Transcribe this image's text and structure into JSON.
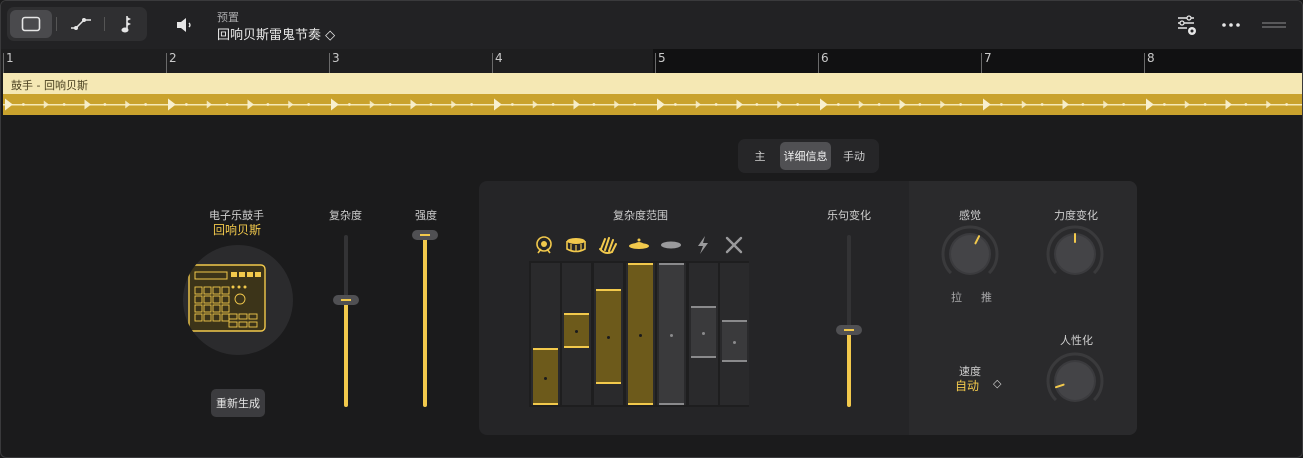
{
  "colors": {
    "accent": "#f2c94c",
    "region_header": "#f5e8b4",
    "region_body": "#c9a22d"
  },
  "toolbar": {
    "view_buttons": [
      {
        "icon": "single-window-icon",
        "active": true
      },
      {
        "icon": "automation-curve-icon",
        "active": false
      },
      {
        "icon": "score-note-icon",
        "active": false
      }
    ],
    "speaker_icon": "speaker-icon",
    "preset_label": "预置",
    "preset_name": "回响贝斯雷鬼节奏 ◇",
    "right_icons": [
      "mixer-settings-icon",
      "more-icon",
      "drag-handle-icon"
    ]
  },
  "ruler": {
    "bars": [
      "1",
      "2",
      "3",
      "4",
      "5",
      "6",
      "7",
      "8"
    ]
  },
  "region": {
    "name": "鼓手 - 回响贝斯"
  },
  "tabs": [
    {
      "label": "主",
      "active": false
    },
    {
      "label": "详细信息",
      "active": true
    },
    {
      "label": "手动",
      "active": false
    }
  ],
  "drummer": {
    "label": "电子乐鼓手",
    "name": "回响贝斯",
    "regenerate": "重新生成"
  },
  "sliders": {
    "complexity": {
      "label": "复杂度",
      "value": 0.62
    },
    "intensity": {
      "label": "强度",
      "value": 1.0
    },
    "fill": {
      "label": "乐句变化",
      "value": 0.45
    }
  },
  "complexity_range": {
    "label": "复杂度范围",
    "instruments": [
      {
        "icon": "kick-drum-icon",
        "color": "gold",
        "low": 0.0,
        "high": 0.4
      },
      {
        "icon": "snare-drum-icon",
        "color": "gold",
        "low": 0.4,
        "high": 0.65
      },
      {
        "icon": "clap-hand-icon",
        "color": "gold",
        "low": 0.15,
        "high": 0.82
      },
      {
        "icon": "cymbal-icon",
        "color": "gold",
        "low": 0.0,
        "high": 1.0
      },
      {
        "icon": "hihat-icon",
        "color": "gray",
        "low": 0.0,
        "high": 1.0
      },
      {
        "icon": "lightning-icon",
        "color": "gray",
        "low": 0.33,
        "high": 0.7
      },
      {
        "icon": "crossed-sticks-icon",
        "color": "gray",
        "low": 0.3,
        "high": 0.6
      }
    ]
  },
  "knobs": {
    "feel": {
      "label": "感觉",
      "pull": "拉",
      "push": "推",
      "value": 0.6
    },
    "velocity": {
      "label": "力度变化",
      "value": 0.5
    },
    "humanize": {
      "label": "人性化",
      "value": 0.1
    }
  },
  "speed": {
    "label": "速度",
    "value": "自动",
    "chevron": "◇"
  }
}
